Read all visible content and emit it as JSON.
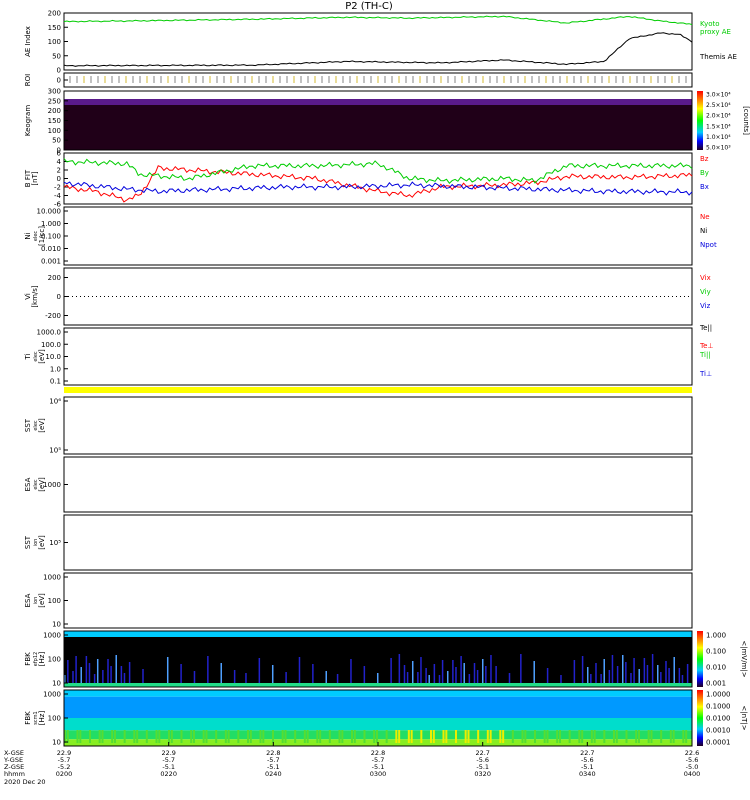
{
  "title": "P2 (TH-C)",
  "colors": {
    "green": "#00cc00",
    "red": "#ff0000",
    "blue": "#0000dd",
    "black": "#000000",
    "yellow": "#ffff00",
    "cyan": "#00ccff",
    "purple": "#400060"
  },
  "chart_data": [
    {
      "panel": "ae",
      "type": "line",
      "ylabel": "AE Index",
      "yticks": [
        0,
        50,
        100,
        150,
        200
      ],
      "ylim": [
        0,
        200
      ],
      "legend": [
        "Kyoto",
        "proxy AE",
        "Themis AE"
      ],
      "series": [
        {
          "name": "Kyoto proxy AE",
          "color": "#00cc00",
          "x": [
            0,
            0.1,
            0.2,
            0.3,
            0.45,
            0.55,
            0.7,
            0.8,
            0.9,
            0.95,
            1.0
          ],
          "values": [
            170,
            172,
            175,
            178,
            185,
            182,
            188,
            165,
            188,
            172,
            160
          ]
        },
        {
          "name": "Themis AE",
          "color": "#000000",
          "x": [
            0,
            0.15,
            0.3,
            0.45,
            0.6,
            0.7,
            0.8,
            0.86,
            0.88,
            0.9,
            0.95,
            0.98,
            1.0
          ],
          "values": [
            15,
            16,
            17,
            30,
            25,
            35,
            20,
            30,
            70,
            110,
            130,
            125,
            100
          ]
        }
      ]
    },
    {
      "panel": "roi",
      "type": "table",
      "ylabel": "ROI",
      "yticks": [
        0
      ]
    },
    {
      "panel": "keogram",
      "type": "heatmap",
      "ylabel": "Keogram",
      "yticks": [
        0,
        50,
        100,
        150,
        200,
        250,
        300
      ],
      "ylim": [
        0,
        300
      ],
      "colorbar_ticks": [
        "3.0×10⁴",
        "2.5×10⁴",
        "2.0×10⁴",
        "1.5×10⁴",
        "1.0×10⁴",
        "5.0×10³"
      ],
      "colorbar_label": "[counts]"
    },
    {
      "panel": "bfield",
      "type": "line",
      "ylabel": "B FIT",
      "unit": "[nT]",
      "yticks": [
        -6,
        -4,
        -2,
        0,
        2,
        4,
        6
      ],
      "ylim": [
        -6,
        6
      ],
      "series": [
        {
          "name": "Bz",
          "color": "#ff0000",
          "x": [
            0,
            0.05,
            0.1,
            0.12,
            0.15,
            0.3,
            0.4,
            0.5,
            0.55,
            0.6,
            0.7,
            0.75,
            0.8,
            0.9,
            1.0
          ],
          "values": [
            -2,
            -3,
            -5,
            -4,
            2.5,
            1,
            0,
            -3,
            -4,
            -2,
            -1.5,
            -1,
            0.5,
            0.3,
            0.8
          ]
        },
        {
          "name": "By",
          "color": "#00cc00",
          "x": [
            0,
            0.1,
            0.12,
            0.2,
            0.3,
            0.4,
            0.5,
            0.55,
            0.6,
            0.7,
            0.75,
            0.8,
            0.9,
            1.0
          ],
          "values": [
            4,
            3.5,
            1,
            0,
            3,
            3,
            3.5,
            0,
            -0.5,
            0,
            -0.5,
            3,
            3,
            3
          ]
        },
        {
          "name": "Bx",
          "color": "#0000dd",
          "x": [
            0,
            0.1,
            0.15,
            0.25,
            0.35,
            0.45,
            0.55,
            0.65,
            0.75,
            0.85,
            1.0
          ],
          "values": [
            -1,
            -2.5,
            -3,
            -2.5,
            -2,
            -2,
            -1.5,
            -2,
            -2.5,
            -3,
            -3.2
          ]
        }
      ]
    },
    {
      "panel": "density",
      "type": "line",
      "ylabel": "Ni",
      "sublabel": "elec",
      "unit": "[1/cc]",
      "yticks": [
        "10.000",
        "1.000",
        "0.100",
        "0.010",
        "0.001"
      ],
      "legend": [
        "Ne",
        "Ni",
        "Npot"
      ]
    },
    {
      "panel": "velocity",
      "type": "line",
      "ylabel": "Vi",
      "unit": "[km/s]",
      "yticks": [
        200,
        0,
        -200
      ],
      "ylim": [
        -300,
        300
      ],
      "legend": [
        "Vix",
        "Viy",
        "Viz"
      ]
    },
    {
      "panel": "temperature",
      "type": "line",
      "ylabel": "Ti",
      "sublabel": "elec",
      "unit": "[eV]",
      "yticks": [
        "1000.0",
        "100.0",
        "10.0",
        "1.0",
        "0.1"
      ],
      "legend": [
        "Te||",
        "Te⊥",
        "Ti||",
        "Ti⊥"
      ]
    },
    {
      "panel": "sst_elec",
      "type": "heatmap",
      "ylabel": "SST",
      "sublabel": "elec",
      "unit": "[eV]",
      "yticks": [
        "10⁶",
        "10⁵"
      ]
    },
    {
      "panel": "esa_elec",
      "type": "heatmap",
      "ylabel": "ESA",
      "sublabel": "elec",
      "unit": "[eV]",
      "yticks": [
        1000
      ]
    },
    {
      "panel": "sst_ion",
      "type": "heatmap",
      "ylabel": "SST",
      "sublabel": "ion",
      "unit": "[eV]",
      "yticks": [
        "10⁵"
      ]
    },
    {
      "panel": "esa_ion",
      "type": "heatmap",
      "ylabel": "ESA",
      "sublabel": "ion",
      "unit": "[eV]",
      "yticks": [
        1000,
        100,
        10
      ]
    },
    {
      "panel": "fbk_e",
      "type": "heatmap",
      "ylabel": "FBK",
      "sublabel": "efp12",
      "unit": "[Hz]",
      "yticks": [
        1000,
        100,
        10
      ],
      "colorbar_ticks": [
        "1.000",
        "0.100",
        "0.010",
        "0.001"
      ],
      "colorbar_label": "<|mV/m|>"
    },
    {
      "panel": "fbk_b",
      "type": "heatmap",
      "ylabel": "FBK",
      "sublabel": "scm1",
      "unit": "[Hz]",
      "yticks": [
        1000,
        100,
        10
      ],
      "colorbar_ticks": [
        "1.0000",
        "0.1000",
        "0.0100",
        "0.0010",
        "0.0001"
      ],
      "colorbar_label": "<|nT|>"
    }
  ],
  "xaxis": {
    "row_labels": [
      "X-GSE",
      "Y-GSE",
      "Z-GSE",
      "hhmm",
      "2020 Dec 20"
    ],
    "columns": [
      {
        "x": 0.0,
        "vals": [
          "22.9",
          "-5.7",
          "-5.2",
          "0200"
        ]
      },
      {
        "x": 0.1667,
        "vals": [
          "22.9",
          "-5.7",
          "-5.1",
          "0220"
        ]
      },
      {
        "x": 0.3333,
        "vals": [
          "22.8",
          "-5.7",
          "-5.1",
          "0240"
        ]
      },
      {
        "x": 0.5,
        "vals": [
          "22.8",
          "-5.7",
          "-5.1",
          "0300"
        ]
      },
      {
        "x": 0.6667,
        "vals": [
          "22.7",
          "-5.6",
          "-5.1",
          "0320"
        ]
      },
      {
        "x": 0.8333,
        "vals": [
          "22.7",
          "-5.6",
          "-5.1",
          "0340"
        ]
      },
      {
        "x": 1.0,
        "vals": [
          "22.6",
          "-5.6",
          "-5.0",
          "0400"
        ]
      }
    ]
  }
}
